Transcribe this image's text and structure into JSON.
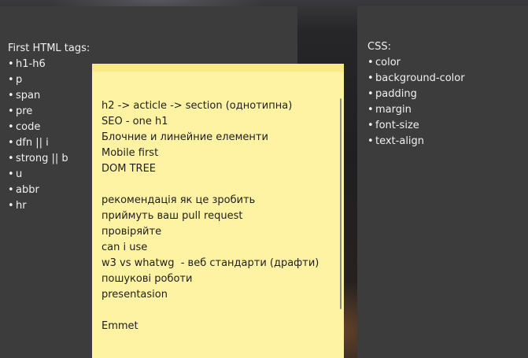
{
  "left_note": {
    "title": "First HTML tags:",
    "bullet": "•",
    "items": [
      "h1-h6",
      "p",
      "span",
      "pre",
      "code",
      "dfn || i",
      "strong || b",
      "u",
      "abbr",
      "hr"
    ]
  },
  "right_note": {
    "title": "CSS:",
    "bullet": "•",
    "items": [
      "color",
      "background-color",
      "padding",
      "margin",
      "font-size",
      "text-align"
    ]
  },
  "yellow_note": {
    "lines": [
      "h2 -> acticle -> section (однотипна)",
      "SEO - one h1",
      "Блочние и линейние елементи",
      "Mobile first",
      "DOM TREE",
      "",
      "рекомендація як це зробить",
      "приймуть ваш pull request",
      "провіряйте",
      "can i use",
      "w3 vs whatwg  - веб стандарти (драфти)",
      "пошукові роботи",
      "presentasion",
      "",
      "Emmet"
    ]
  },
  "colors": {
    "dark_note_bg": "#3c3c3c",
    "yellow_note_bg": "#fef3a2",
    "yellow_header": "#fbe886"
  }
}
